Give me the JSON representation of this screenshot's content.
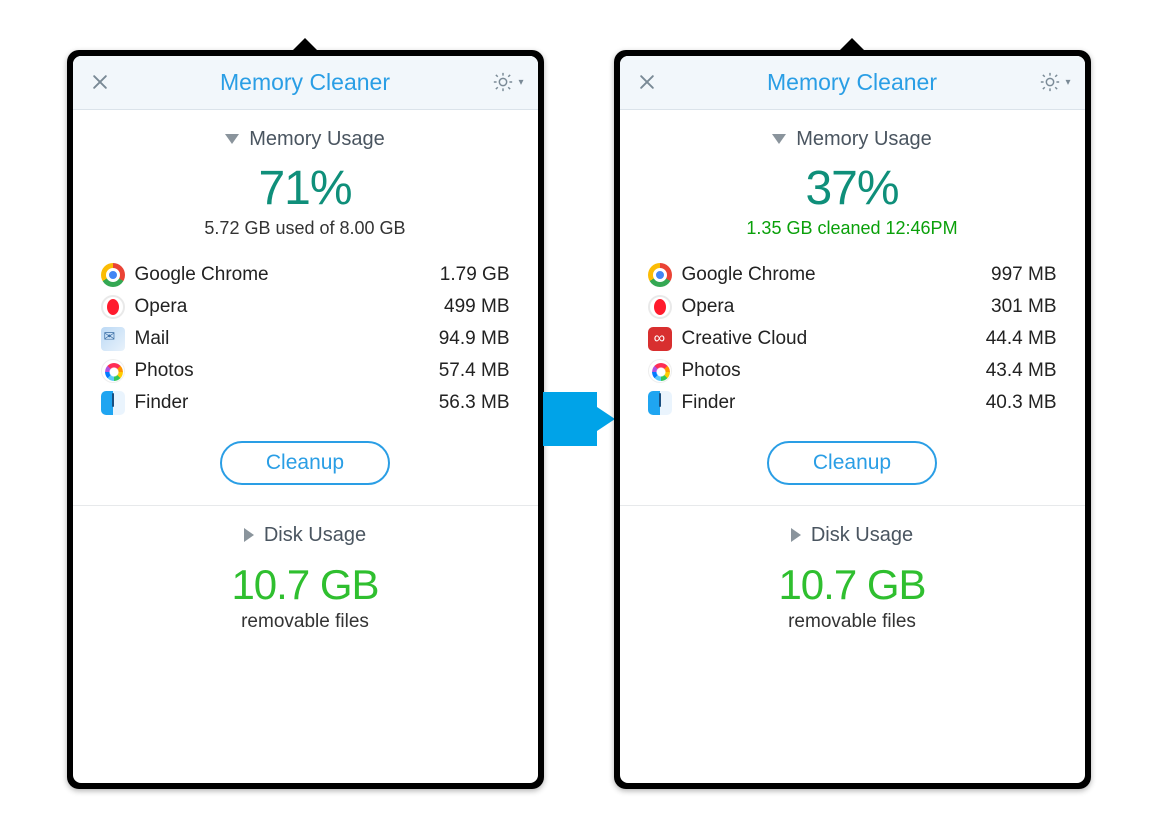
{
  "left": {
    "header": {
      "title": "Memory Cleaner"
    },
    "memory": {
      "section_label": "Memory Usage",
      "percent": "71%",
      "sub": "5.72 GB used of 8.00 GB",
      "sub_style": "normal",
      "apps": [
        {
          "icon": "chrome",
          "name": "Google Chrome",
          "size": "1.79 GB"
        },
        {
          "icon": "opera",
          "name": "Opera",
          "size": "499 MB"
        },
        {
          "icon": "mail",
          "name": "Mail",
          "size": "94.9 MB"
        },
        {
          "icon": "photos",
          "name": "Photos",
          "size": "57.4 MB"
        },
        {
          "icon": "finder",
          "name": "Finder",
          "size": "56.3 MB"
        }
      ],
      "cleanup_label": "Cleanup"
    },
    "disk": {
      "section_label": "Disk Usage",
      "big": "10.7 GB",
      "sub": "removable files"
    }
  },
  "right": {
    "header": {
      "title": "Memory Cleaner"
    },
    "memory": {
      "section_label": "Memory Usage",
      "percent": "37%",
      "sub": "1.35 GB cleaned 12:46PM",
      "sub_style": "green",
      "apps": [
        {
          "icon": "chrome",
          "name": "Google Chrome",
          "size": "997 MB"
        },
        {
          "icon": "opera",
          "name": "Opera",
          "size": "301 MB"
        },
        {
          "icon": "cc",
          "name": "Creative Cloud",
          "size": "44.4 MB"
        },
        {
          "icon": "photos",
          "name": "Photos",
          "size": "43.4 MB"
        },
        {
          "icon": "finder",
          "name": "Finder",
          "size": "40.3 MB"
        }
      ],
      "cleanup_label": "Cleanup"
    },
    "disk": {
      "section_label": "Disk Usage",
      "big": "10.7 GB",
      "sub": "removable files"
    }
  }
}
